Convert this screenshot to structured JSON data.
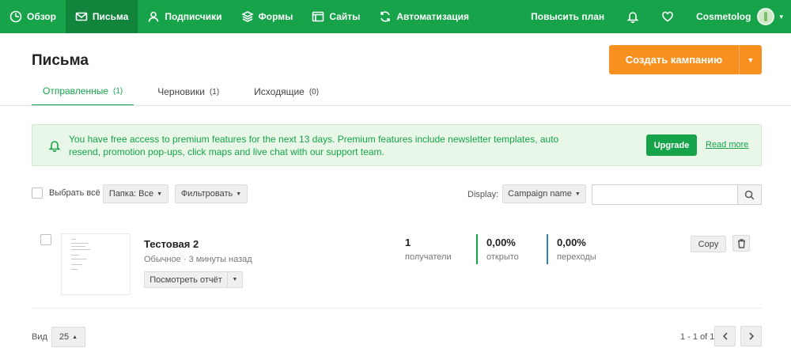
{
  "nav": {
    "items": [
      {
        "label": "Обзор",
        "icon": "dashboard-icon"
      },
      {
        "label": "Письма",
        "icon": "mail-icon",
        "active": true
      },
      {
        "label": "Подписчики",
        "icon": "user-icon"
      },
      {
        "label": "Формы",
        "icon": "layers-icon"
      },
      {
        "label": "Сайты",
        "icon": "browser-icon"
      },
      {
        "label": "Автоматизация",
        "icon": "refresh-icon"
      }
    ],
    "upgrade": "Повысить план",
    "account": "Cosmetolog",
    "brand_color": "#16a34a"
  },
  "page": {
    "title": "Письма",
    "create_button": "Создать кампанию",
    "accent_color": "#f7901e"
  },
  "tabs": [
    {
      "label": "Отправленные",
      "count": "(1)"
    },
    {
      "label": "Черновики",
      "count": "(1)"
    },
    {
      "label": "Исходящие",
      "count": "(0)"
    }
  ],
  "notice": {
    "message": "You have free access to premium features for the next 13 days. Premium features include newsletter templates, auto resend, promotion pop-ups, click maps and live chat with our support team.",
    "upgrade_button": "Upgrade",
    "read_more": "Read more"
  },
  "filters": {
    "select_all": "Выбрать всё",
    "folder": "Папка: Все",
    "filter": "Фильтровать",
    "display_label": "Display:",
    "display_value": "Campaign name",
    "search_placeholder": ""
  },
  "campaign": {
    "name": "Тестовая 2",
    "meta": "Обычное · 3 минуты назад",
    "report_button": "Посмотреть отчёт",
    "recipients_value": "1",
    "recipients_label": "получатели",
    "opened_value": "0,00%",
    "opened_label": "открыто",
    "opened_color": "#16a34a",
    "clicks_value": "0,00%",
    "clicks_label": "переходы",
    "clicks_color": "#2f7fc1",
    "copy_button": "Copy"
  },
  "footer": {
    "view_label": "Вид",
    "per_page": "25",
    "pager": "1 - 1 of 1"
  }
}
